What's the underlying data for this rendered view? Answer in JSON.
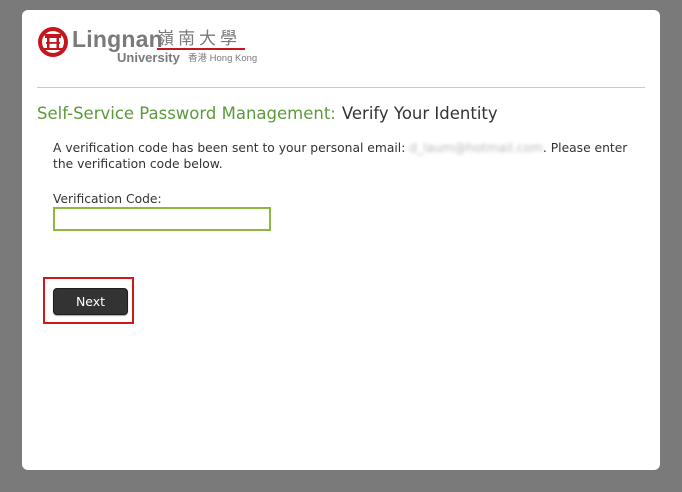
{
  "logo": {
    "name_en": "Lingnan",
    "name_zh": "嶺南大學",
    "university": "University",
    "location": "香港 Hong Kong"
  },
  "header": {
    "app_title": "Self-Service Password Management:",
    "page_title": "Verify Your Identity"
  },
  "message": {
    "before": "A verification code has been sent to your personal email: ",
    "email": "d_laum@hotmail.com",
    "after": ". Please enter the verification code below."
  },
  "form": {
    "code_label": "Verification Code:",
    "code_value": "",
    "next_label": "Next"
  },
  "colors": {
    "background": "#7a7a7a",
    "heading_green": "#5b9a3c",
    "input_border": "#8bb743",
    "button": "#333333",
    "highlight": "#d3151c",
    "brand_red": "#c4161c"
  }
}
